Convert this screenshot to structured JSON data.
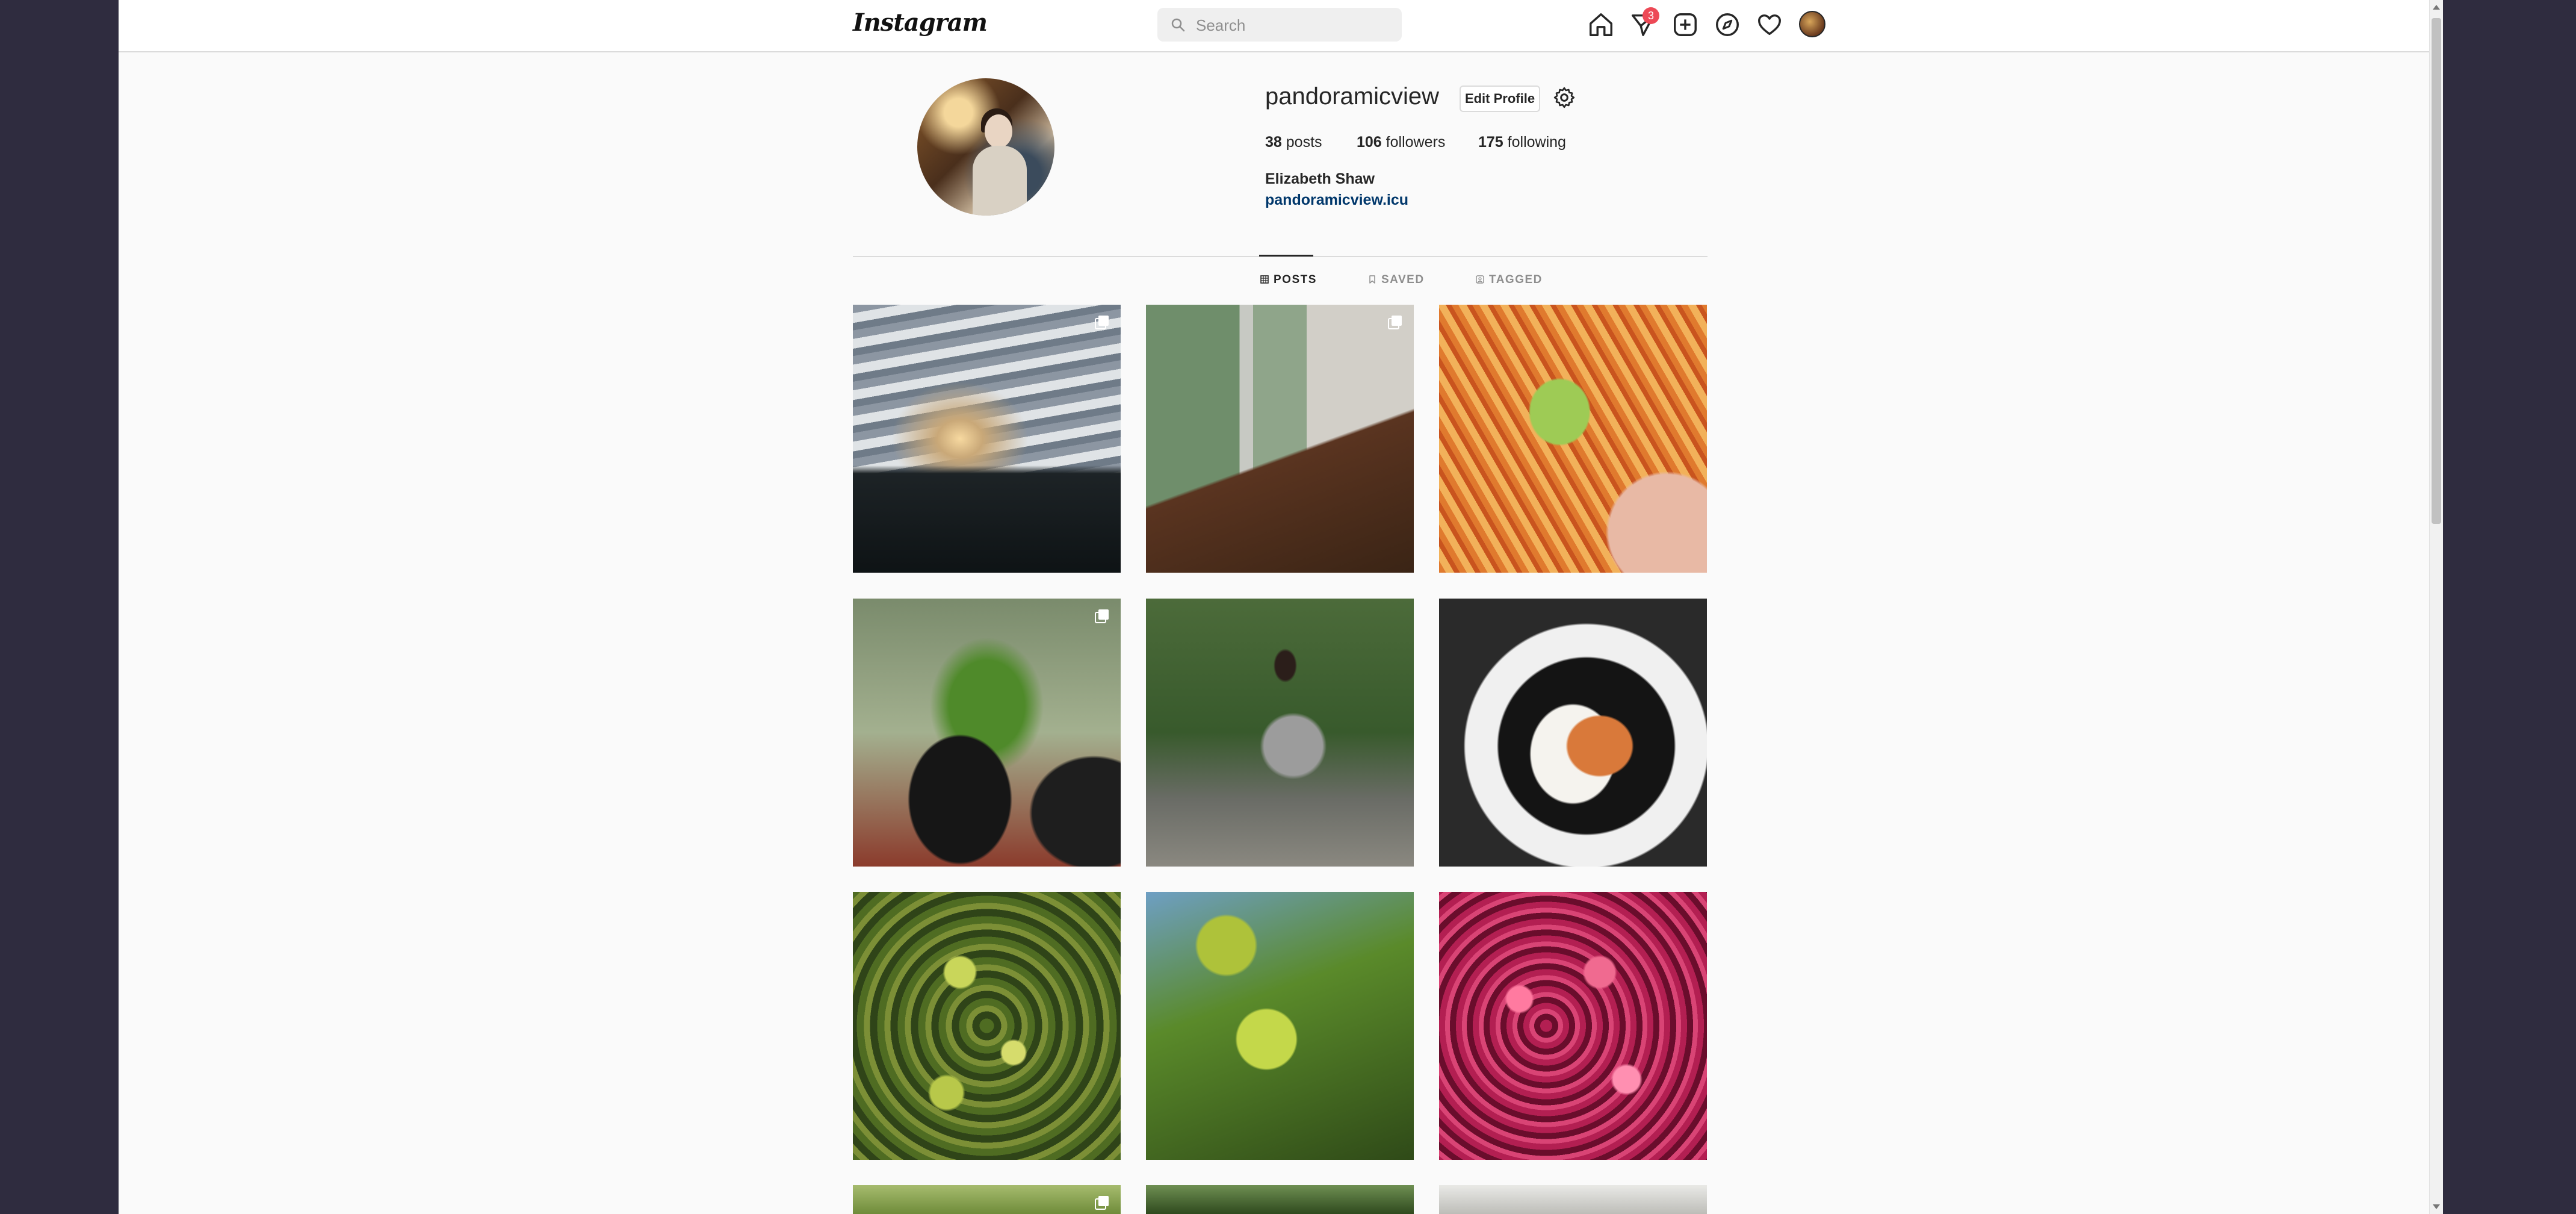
{
  "nav": {
    "logo_text": "Instagram",
    "search": {
      "placeholder": "Search",
      "value": ""
    },
    "icons": [
      "home-icon",
      "direct-messages-icon",
      "new-post-icon",
      "explore-icon",
      "activity-heart-icon",
      "profile-avatar-icon"
    ],
    "messages_badge": "3"
  },
  "profile": {
    "username": "pandoramicview",
    "edit_profile_label": "Edit Profile",
    "stats": {
      "posts_count": "38",
      "posts_label": "posts",
      "followers_count": "106",
      "followers_label": "followers",
      "following_count": "175",
      "following_label": "following"
    },
    "full_name": "Elizabeth Shaw",
    "website": "pandoramicview.icu"
  },
  "tabs": [
    {
      "label": "POSTS",
      "icon": "grid-icon",
      "active": true
    },
    {
      "label": "SAVED",
      "icon": "bookmark-icon",
      "active": false
    },
    {
      "label": "TAGGED",
      "icon": "tagged-icon",
      "active": false
    }
  ],
  "posts": [
    {
      "subject": "sunset-over-trees",
      "multiple": true
    },
    {
      "subject": "window-sill-plants",
      "multiple": true
    },
    {
      "subject": "snack-with-wasabi",
      "multiple": false
    },
    {
      "subject": "potted-seedlings",
      "multiple": true
    },
    {
      "subject": "woman-on-garden-path",
      "multiple": false
    },
    {
      "subject": "katsu-curry-plate",
      "multiple": false
    },
    {
      "subject": "succulent-flowers",
      "multiple": false
    },
    {
      "subject": "green-spurge-flowers",
      "multiple": false
    },
    {
      "subject": "pink-blossoms",
      "multiple": false
    },
    {
      "subject": "lavender-plant",
      "multiple": true
    },
    {
      "subject": "leafy-plant",
      "multiple": false
    },
    {
      "subject": "white-object",
      "multiple": false
    }
  ],
  "colors": {
    "accent_link": "#00376b",
    "badge": "#ed4956",
    "page_background": "#fafafa",
    "desktop_background": "#2f2c3f"
  }
}
